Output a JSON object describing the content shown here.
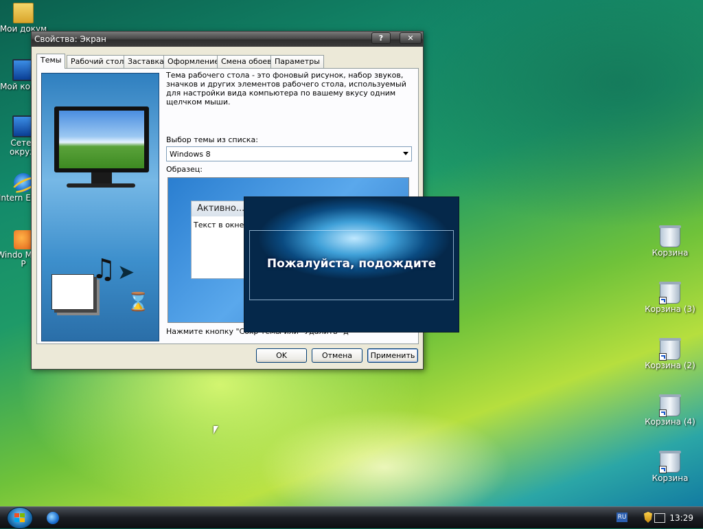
{
  "desktop": {
    "left_icons": [
      {
        "label": "Мои докум",
        "icon": "folder-icon"
      },
      {
        "label": "Мой компь",
        "icon": "computer-icon"
      },
      {
        "label": "Сетев окруж",
        "icon": "network-icon"
      },
      {
        "label": "Intern Explo",
        "icon": "internet-explorer-icon"
      },
      {
        "label": "Windo Media P",
        "icon": "media-player-icon"
      }
    ],
    "right_icons": [
      {
        "label": "Корзина"
      },
      {
        "label": "Корзина (3)"
      },
      {
        "label": "Корзина (2)"
      },
      {
        "label": "Корзина (4)"
      },
      {
        "label": "Корзина"
      }
    ]
  },
  "dialog": {
    "title": "Свойства: Экран",
    "help_label": "?",
    "close_label": "✕",
    "tabs": [
      "Темы",
      "Рабочий стол",
      "Заставка",
      "Оформление",
      "Смена обоев",
      "Параметры"
    ],
    "active_tab": "Темы",
    "description": "Тема рабочего стола - это фоновый рисунок, набор звуков, значков и других элементов рабочего стола, используемый для настройки вида компьютера по вашему вкусу одним щелчком мыши.",
    "theme_select_label": "Выбор темы из списка:",
    "theme_value": "Windows 8",
    "sample_label": "Образец:",
    "preview": {
      "window_title": "Активно...",
      "window_text": "Текст в окне"
    },
    "bottom_text": "Нажмите кнопку \"Сохр темы или \"Удалить\" д",
    "buttons": {
      "ok": "OK",
      "cancel": "Отмена",
      "apply": "Применить"
    }
  },
  "wait_popup": {
    "message": "Пожалуйста, подождите"
  },
  "taskbar": {
    "language": "RU",
    "clock": "13:29"
  }
}
